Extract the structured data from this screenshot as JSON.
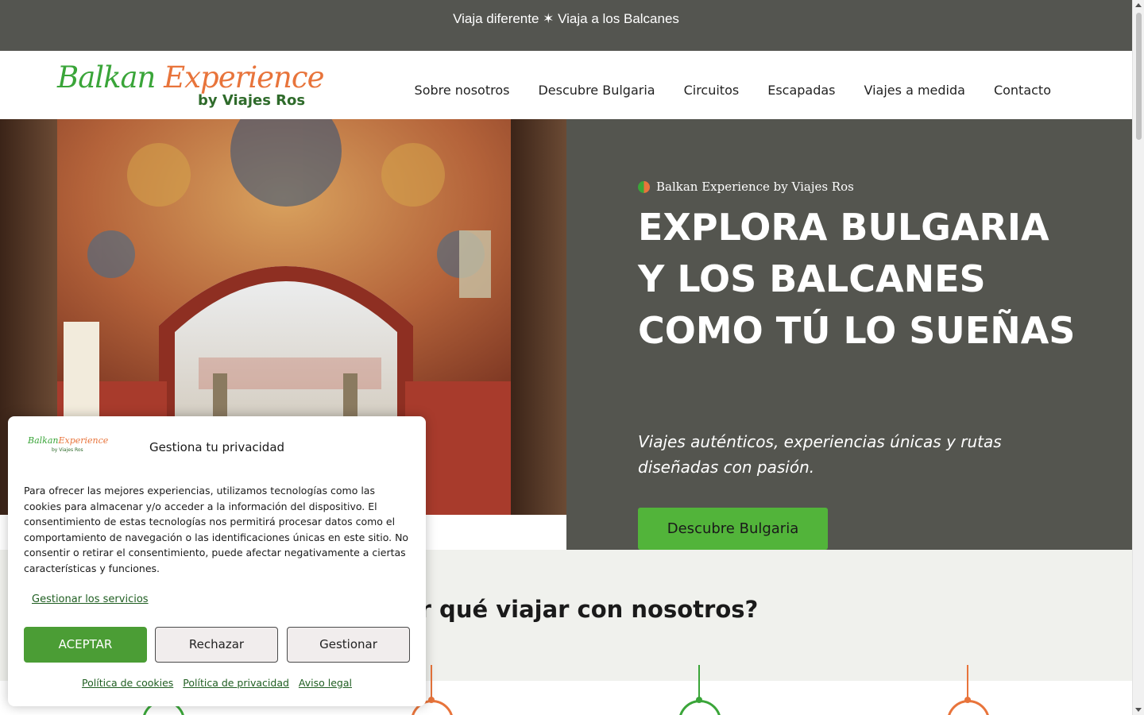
{
  "topbar": {
    "text": "Viaja diferente ✶ Viaja a los Balcanes"
  },
  "header": {
    "logo": {
      "word1": "Balkan",
      "word2": "Experience",
      "sub": "by Viajes Ros"
    },
    "nav": [
      "Sobre nosotros",
      "Descubre Bulgaria",
      "Circuitos",
      "Escapadas",
      "Viajes a medida",
      "Contacto"
    ]
  },
  "hero": {
    "brandline": "Balkan Experience by Viajes Ros",
    "title": "EXPLORA BULGARIA Y LOS BALCANES COMO TÚ LO SUEÑAS",
    "subtitle": "Viajes auténticos, experiencias únicas y rutas diseñadas con pasión.",
    "cta": "Descubre Bulgaria"
  },
  "why": {
    "title": "¿Por qué viajar con nosotros?"
  },
  "cookie": {
    "logo": {
      "word1": "Balkan",
      "word2": "Experience",
      "sub": "by Viajes Ros"
    },
    "title": "Gestiona tu privacidad",
    "text": "Para ofrecer las mejores experiencias, utilizamos tecnologías como las cookies para almacenar y/o acceder a la información del dispositivo. El consentimiento de estas tecnologías nos permitirá procesar datos como el comportamiento de navegación o las identificaciones únicas en este sitio. No consentir o retirar el consentimiento, puede afectar negativamente a ciertas características y funciones.",
    "manage_services": "Gestionar los servicios",
    "accept": "ACEPTAR",
    "deny": "Rechazar",
    "view": "Gestionar",
    "links": [
      "Política de cookies",
      "Política de privacidad",
      "Aviso legal"
    ]
  },
  "colors": {
    "topbar": "#545550",
    "accent_green": "#52b43a",
    "accent_orange": "#e8743b",
    "dark_green": "#2f6b2b"
  }
}
